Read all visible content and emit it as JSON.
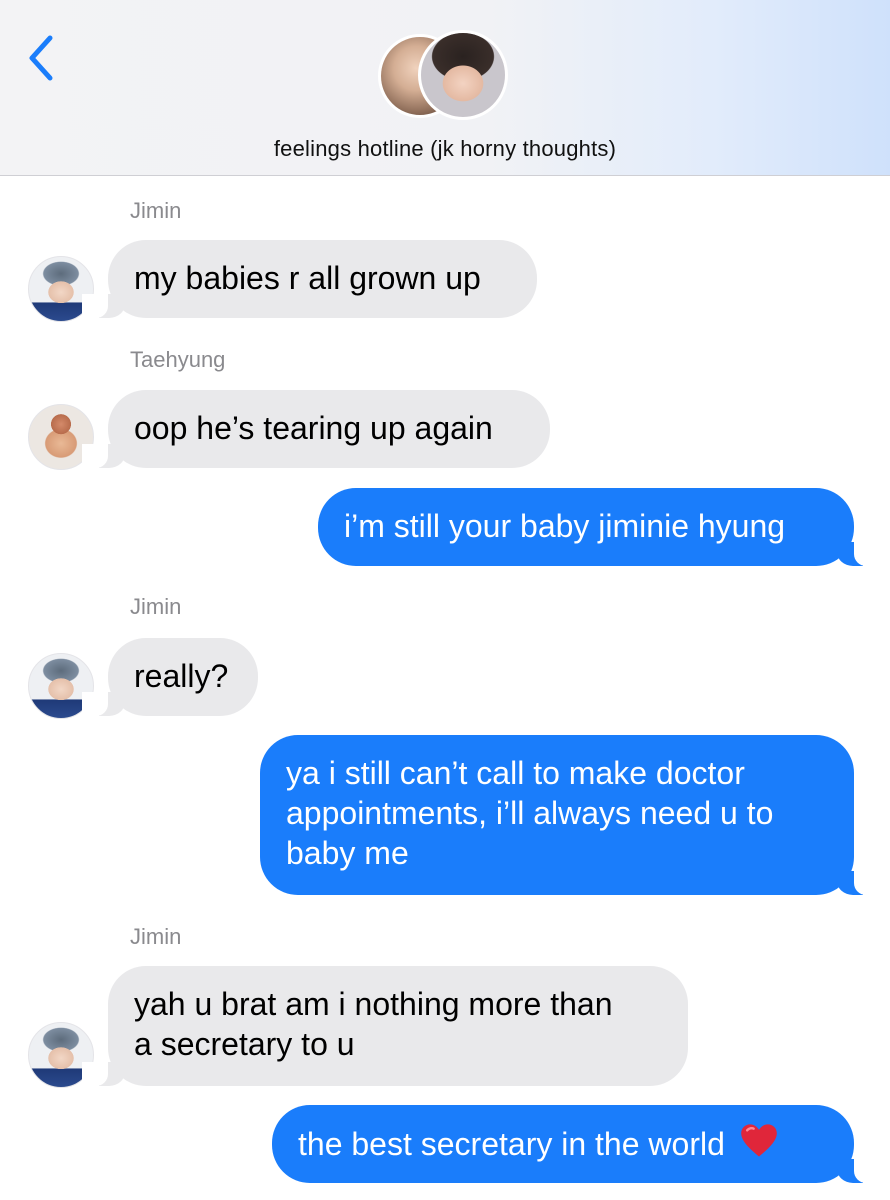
{
  "header": {
    "title": "feelings hotline (jk horny thoughts)",
    "back_icon": "chevron-left-icon",
    "accent_color": "#1a7dfb"
  },
  "messages": [
    {
      "direction": "incoming",
      "sender": "Jimin",
      "text": "my babies r all grown up"
    },
    {
      "direction": "incoming",
      "sender": "Taehyung",
      "text": "oop he’s tearing up again"
    },
    {
      "direction": "outgoing",
      "text": "i’m still your baby jiminie hyung"
    },
    {
      "direction": "incoming",
      "sender": "Jimin",
      "text": "really?"
    },
    {
      "direction": "outgoing",
      "lines": [
        "ya i still can’t call to make doctor",
        "appointments, i’ll always need u to",
        "baby me"
      ]
    },
    {
      "direction": "incoming",
      "sender": "Jimin",
      "lines": [
        "yah u brat am i nothing more than",
        "a secretary to u"
      ]
    },
    {
      "direction": "outgoing",
      "text": "the best secretary in the world",
      "emoji": "red-heart-icon"
    }
  ],
  "colors": {
    "incoming_bubble": "#e9e9eb",
    "outgoing_bubble": "#1a7dfb",
    "sender_label": "#8a8a8e"
  }
}
